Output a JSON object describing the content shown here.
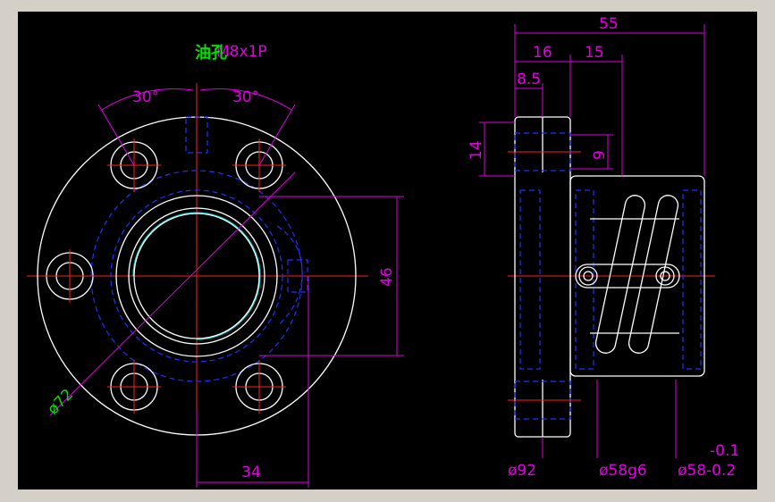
{
  "drawing": {
    "background": "#000000",
    "frame_color": "#d4d0c8",
    "colors": {
      "outline": "#ffffff",
      "centerline": "#ff2020",
      "hidden": "#2030ff",
      "dimension": "#e000e0",
      "label": "#00e000",
      "thread": "#00c8c8"
    }
  },
  "front_view": {
    "oil_hole_label": "油孔",
    "thread_label": "M8x1P",
    "angle_left": "30°",
    "angle_right": "30°",
    "dim_height": "46",
    "dim_bolt_offset": "34",
    "dim_diameter": "ø72"
  },
  "side_view": {
    "dim_total": "55",
    "dim_flange": "16",
    "dim_pitch": "15",
    "dim_small": "8.5",
    "dim_counterbore": "14",
    "dim_hole": "9",
    "dim_od_flange": "ø92",
    "dim_body_fit": "ø58g6",
    "dim_body": "ø58-0.2",
    "tol_upper": "-0.1"
  }
}
